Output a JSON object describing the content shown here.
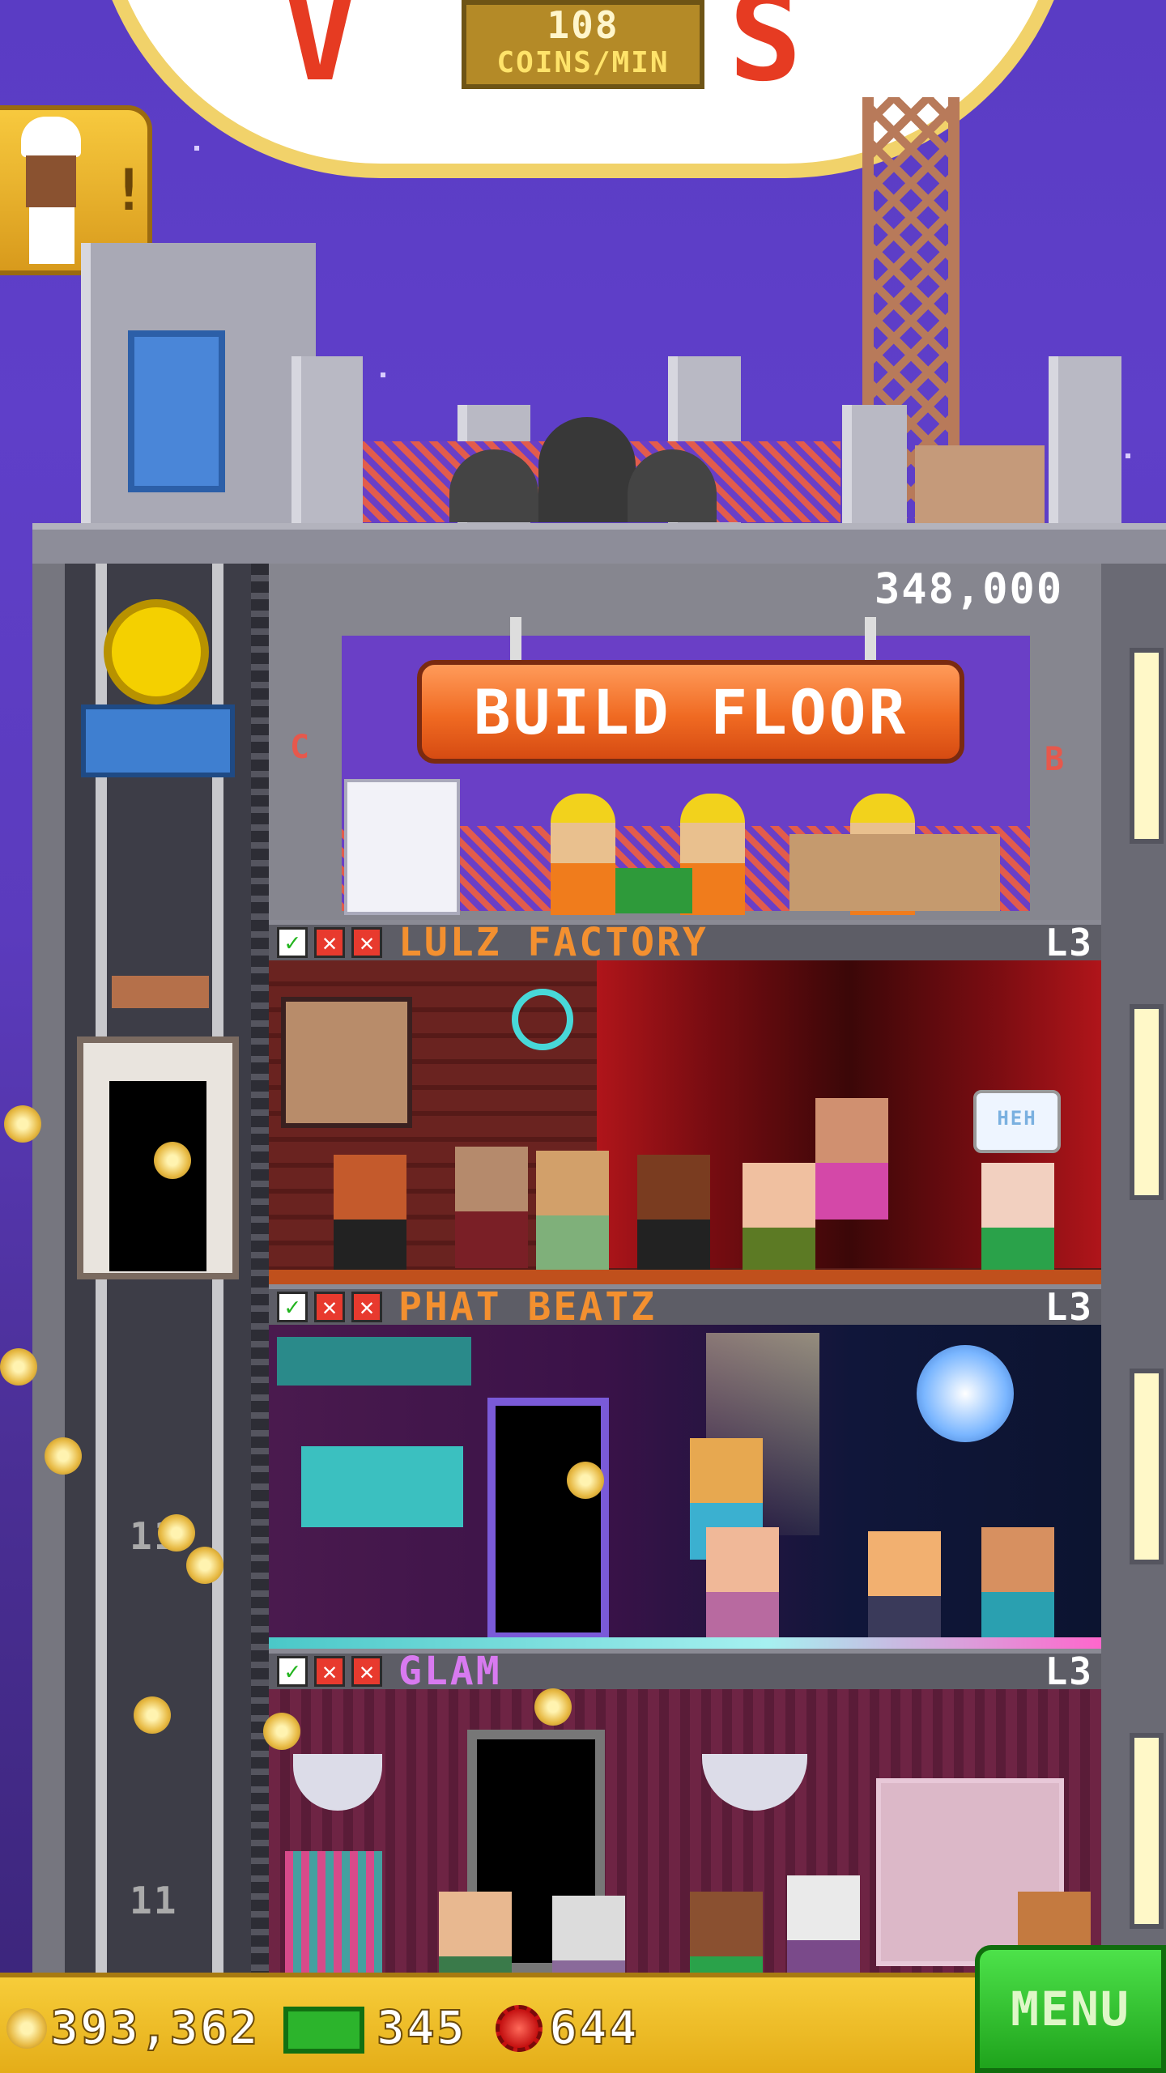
{
  "header": {
    "coins_per_min_value": "108",
    "coins_per_min_unit": "COINS/MIN"
  },
  "build_floor": {
    "price": "348,000",
    "button_label": "BUILD FLOOR",
    "left_marker": "C",
    "right_marker": "B"
  },
  "floors": [
    {
      "name": "LULZ FACTORY",
      "level": "L3",
      "name_color": "#f39030",
      "speech": "HEH"
    },
    {
      "name": "PHAT BEATZ",
      "level": "L3",
      "name_color": "#f39030"
    },
    {
      "name": "GLAM",
      "level": "L3",
      "name_color": "#d87af0"
    }
  ],
  "elevator": {
    "floor_labels": [
      "11",
      "11"
    ]
  },
  "currency": {
    "coins": "393,362",
    "bux": "345",
    "tokens": "644"
  },
  "menu_label": "MENU"
}
